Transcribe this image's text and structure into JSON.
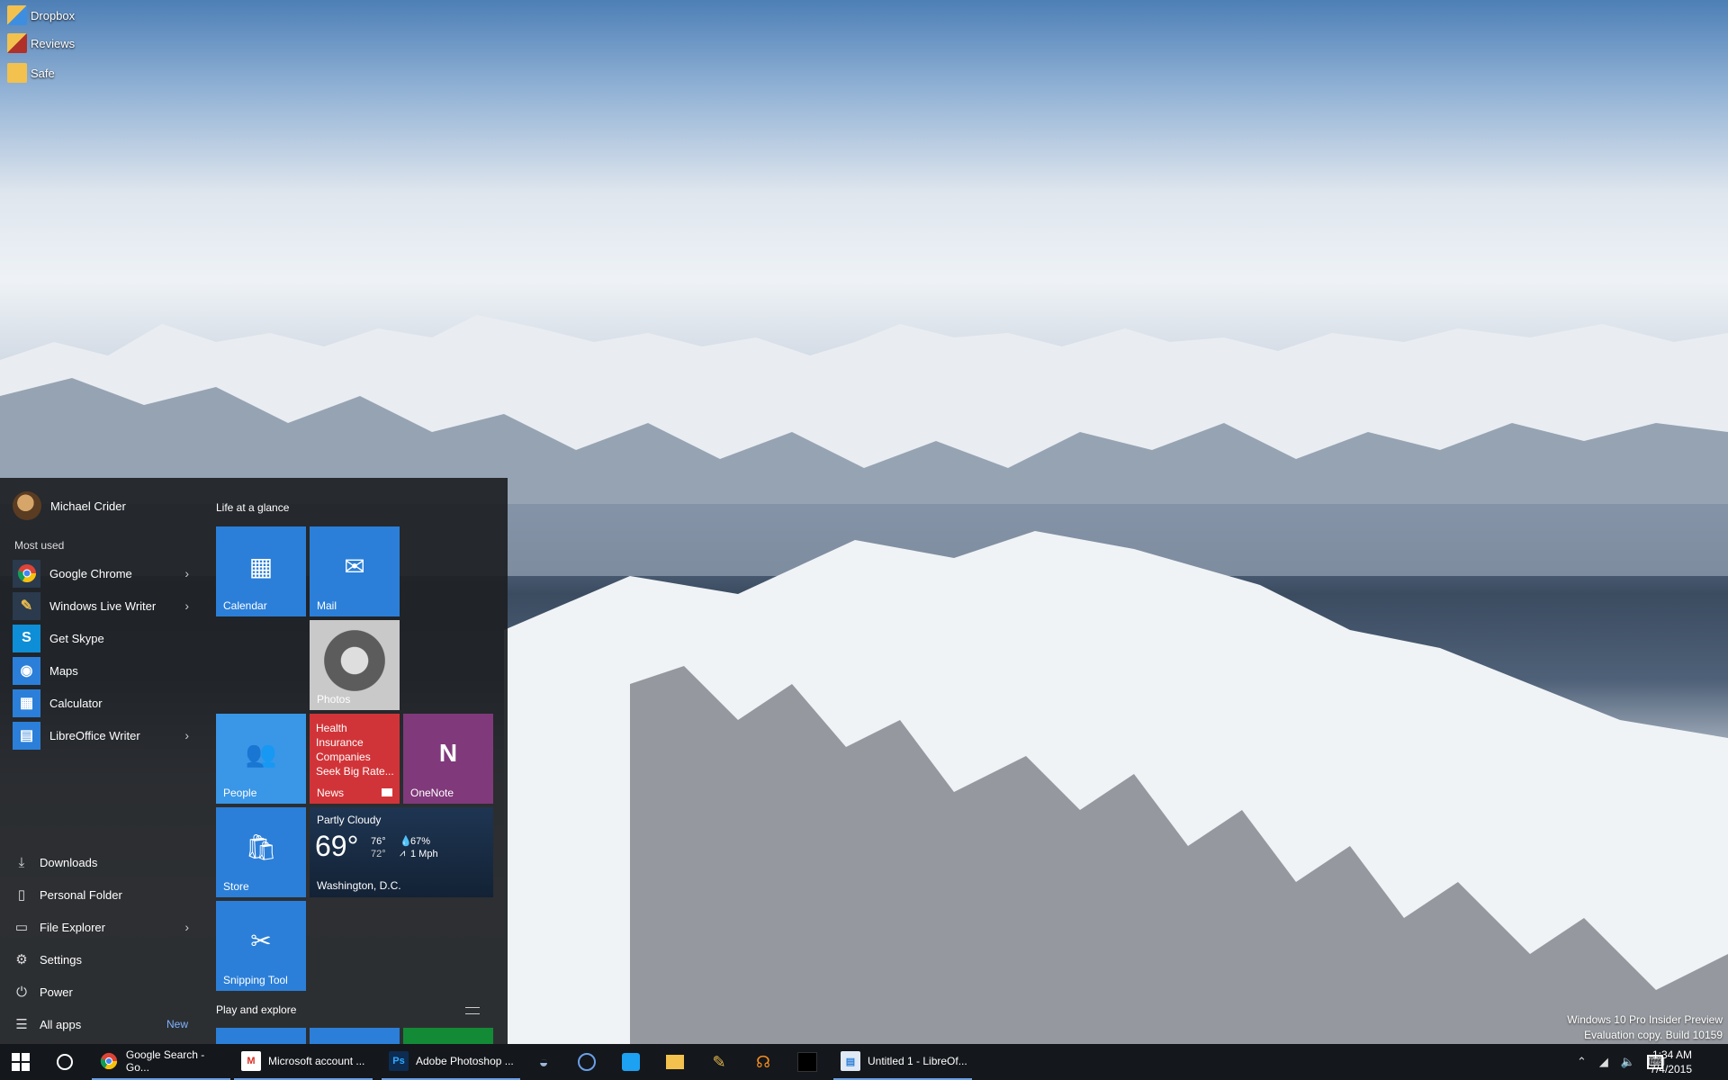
{
  "desktop": {
    "icons": [
      {
        "label": "Dropbox",
        "icon": "dropbox-icon"
      },
      {
        "label": "Reviews",
        "icon": "folder-icon"
      },
      {
        "label": "Safe",
        "icon": "folder-icon"
      }
    ],
    "watermark": {
      "line1": "Windows 10 Pro Insider Preview",
      "line2": "Evaluation copy. Build 10159"
    }
  },
  "start_menu": {
    "user_name": "Michael Crider",
    "most_used_label": "Most used",
    "most_used": [
      {
        "label": "Google Chrome",
        "icon": "chrome-icon",
        "has_submenu": true
      },
      {
        "label": "Windows Live Writer",
        "icon": "live-writer-icon",
        "has_submenu": true
      },
      {
        "label": "Get Skype",
        "icon": "skype-icon",
        "has_submenu": false
      },
      {
        "label": "Maps",
        "icon": "maps-icon",
        "has_submenu": false
      },
      {
        "label": "Calculator",
        "icon": "calculator-icon",
        "has_submenu": false
      },
      {
        "label": "LibreOffice Writer",
        "icon": "libreoffice-writer-icon",
        "has_submenu": true
      }
    ],
    "system_items": [
      {
        "label": "Downloads",
        "icon": "download-icon"
      },
      {
        "label": "Personal Folder",
        "icon": "person-folder-icon"
      },
      {
        "label": "File Explorer",
        "icon": "file-explorer-icon"
      },
      {
        "label": "Settings",
        "icon": "gear-icon"
      },
      {
        "label": "Power",
        "icon": "power-icon"
      },
      {
        "label": "All apps",
        "icon": "list-icon"
      }
    ],
    "all_apps_badge": "New",
    "groups": {
      "life_at_a_glance": "Life at a glance",
      "play_and_explore": "Play and explore"
    },
    "tiles": {
      "calendar": "Calendar",
      "mail": "Mail",
      "photos": "Photos",
      "people": "People",
      "news_headline": "Health Insurance Companies Seek Big Rate...",
      "news_label": "News",
      "onenote": "OneNote",
      "store": "Store",
      "snipping_tool": "Snipping Tool"
    },
    "weather": {
      "condition": "Partly Cloudy",
      "temperature": "69°",
      "high": "76°",
      "low": "72°",
      "humidity": "67%",
      "wind": "1 Mph",
      "city": "Washington, D.C."
    }
  },
  "taskbar": {
    "tasks": [
      {
        "label": "Google Search - Go...",
        "icon": "chrome-icon"
      },
      {
        "label": "Microsoft account ...",
        "icon": "gmail-icon"
      },
      {
        "label": "Adobe Photoshop ...",
        "icon": "photoshop-icon"
      },
      {
        "label": "Untitled 1 - LibreOf...",
        "icon": "libreoffice-writer-icon"
      }
    ],
    "pinned": [
      "steam-icon",
      "skype-icon",
      "twitter-icon",
      "file-explorer-icon",
      "live-writer-icon",
      "headphones-icon",
      "app-icon"
    ],
    "clock": {
      "time": "1:34 AM",
      "date": "7/4/2015"
    }
  },
  "colors": {
    "tile_blue": "#2b7fd8",
    "tile_light_blue": "#3a96e6",
    "news_red": "#d13438",
    "onenote_purple": "#80397b",
    "green": "#138a36",
    "taskbar": "#14171c"
  }
}
